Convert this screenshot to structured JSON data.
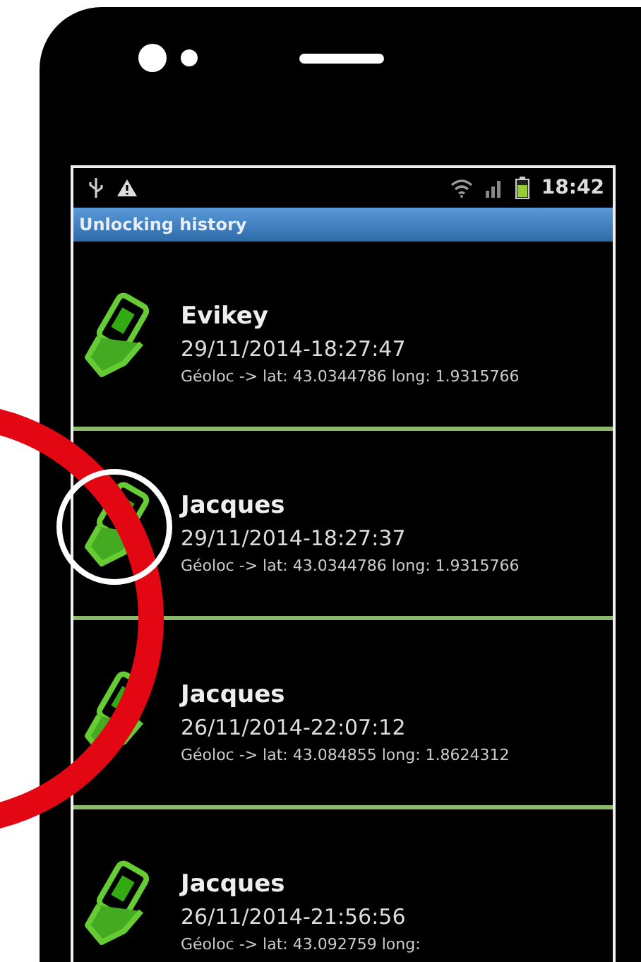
{
  "status_bar": {
    "time": "18:42"
  },
  "title": "Unlocking history",
  "entries": [
    {
      "name": "Evikey",
      "datetime": "29/11/2014-18:27:47",
      "location": "Géoloc -> lat: 43.0344786 long: 1.9315766"
    },
    {
      "name": "Jacques",
      "datetime": "29/11/2014-18:27:37",
      "location": "Géoloc -> lat: 43.0344786 long: 1.9315766"
    },
    {
      "name": "Jacques",
      "datetime": "26/11/2014-22:07:12",
      "location": "Géoloc -> lat: 43.084855 long: 1.8624312"
    },
    {
      "name": "Jacques",
      "datetime": "26/11/2014-21:56:56",
      "location": "Géoloc -> lat: 43.092759 long:"
    }
  ]
}
